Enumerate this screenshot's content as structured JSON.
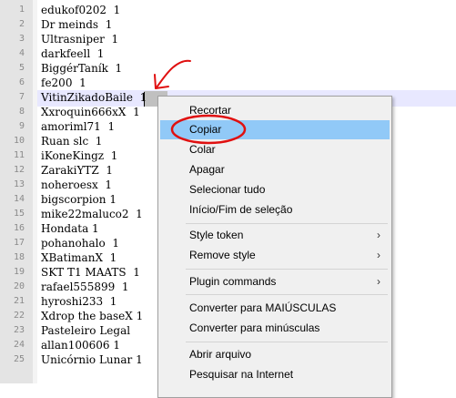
{
  "editor": {
    "lines": [
      {
        "num": "1",
        "text": "edukof0202  1"
      },
      {
        "num": "2",
        "text": "Dr meinds  1"
      },
      {
        "num": "3",
        "text": "Ultrasniper  1"
      },
      {
        "num": "4",
        "text": "darkfeell  1"
      },
      {
        "num": "5",
        "text": "BiggérTaník  1"
      },
      {
        "num": "6",
        "text": "fe200  1"
      },
      {
        "num": "7",
        "text": "VitinZikadoBaile  1"
      },
      {
        "num": "8",
        "text": "Xxroquin666xX  1"
      },
      {
        "num": "9",
        "text": "amoriml71  1"
      },
      {
        "num": "10",
        "text": "Ruan slc  1"
      },
      {
        "num": "11",
        "text": "iKoneKingz  1"
      },
      {
        "num": "12",
        "text": "ZarakiYTZ  1"
      },
      {
        "num": "13",
        "text": "noheroesx  1"
      },
      {
        "num": "14",
        "text": "bigscorpion 1"
      },
      {
        "num": "15",
        "text": "mike22maluco2  1"
      },
      {
        "num": "16",
        "text": "Hondata 1"
      },
      {
        "num": "17",
        "text": "pohanohalo  1"
      },
      {
        "num": "18",
        "text": "XBatimanX  1"
      },
      {
        "num": "19",
        "text": "SKT T1 MAATS  1"
      },
      {
        "num": "20",
        "text": "rafael555899  1"
      },
      {
        "num": "21",
        "text": "hyroshi233  1"
      },
      {
        "num": "22",
        "text": "Xdrop the baseX 1"
      },
      {
        "num": "23",
        "text": "Pasteleiro Legal"
      },
      {
        "num": "24",
        "text": "allan100606 1"
      },
      {
        "num": "25",
        "text": "Unicórnio Lunar 1"
      }
    ]
  },
  "context_menu": {
    "cut": "Recortar",
    "copy": "Copiar",
    "paste": "Colar",
    "delete": "Apagar",
    "select_all": "Selecionar tudo",
    "begin_end_select": "Início/Fim de seleção",
    "style_token": "Style token",
    "remove_style": "Remove style",
    "plugin_commands": "Plugin commands",
    "to_upper": "Converter para MAIÚSCULAS",
    "to_lower": "Converter para minúsculas",
    "open_file": "Abrir arquivo",
    "search_internet": "Pesquisar na Internet",
    "submenu_arrow": "›"
  },
  "colors": {
    "menu_highlight": "#91c9f7",
    "annotation_red": "#e01010",
    "current_line": "#e8e8ff"
  }
}
